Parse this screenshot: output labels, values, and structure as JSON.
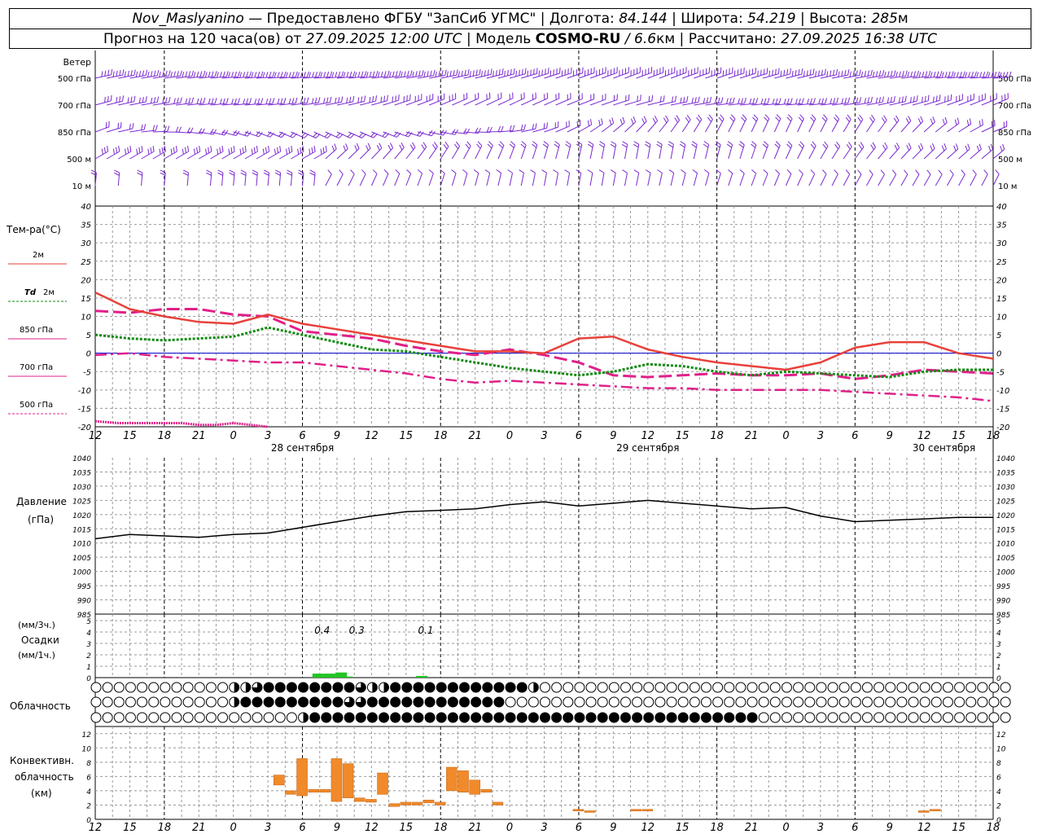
{
  "header": {
    "station": "Nov_Maslyanino",
    "provider": " — Предоставлено ФГБУ \"ЗапСиб УГМС\" | Долгота: ",
    "lon": "84.144",
    "lat_label": " | Широта: ",
    "lat": "54.219",
    "alt_label": " | Высота: ",
    "alt": "285",
    "alt_unit": "м",
    "forecast_label": "Прогноз на 120 часа(ов) от ",
    "forecast_time": "27.09.2025 12:00 UTC",
    "model_label": "  | Модель ",
    "model": "COSMO-RU",
    "model_res": " / 6.6",
    "model_res_unit": "км | Рассчитано: ",
    "calc_time": "27.09.2025 16:38 UTC"
  },
  "colors": {
    "t2m": "#e8413a",
    "td2m": "#108a10",
    "t850": "#e0208a",
    "t700": "#e0208a",
    "t500": "#e0208a",
    "wind": "#7a2ad0",
    "pressure": "#000000",
    "precip": "#22c422",
    "convective": "#f08a2a",
    "grid": "#999999"
  },
  "chart_data": [
    {
      "type": "wind_barbs",
      "title": "Ветер",
      "levels": [
        "500 гПа",
        "700 гПа",
        "850 гПа",
        "500 м",
        "10 м"
      ]
    },
    {
      "type": "line",
      "title": "Тем-ра(°C)",
      "ylim": [
        -20,
        40
      ],
      "yticks": [
        40,
        35,
        30,
        25,
        20,
        15,
        10,
        5,
        0,
        -5,
        -10,
        -15,
        -20
      ],
      "x_hours": [
        0,
        6,
        12,
        18,
        24,
        30,
        36,
        42,
        48,
        54,
        60,
        66,
        72,
        78,
        84,
        90,
        96,
        102,
        108,
        114,
        120
      ],
      "x_tick_labels": [
        "12",
        "15",
        "18",
        "21",
        "0",
        "3",
        "6",
        "9",
        "12",
        "15",
        "18",
        "21",
        "0",
        "3",
        "6",
        "9",
        "12",
        "15",
        "18",
        "21",
        "0",
        "3",
        "6",
        "9",
        "12",
        "15",
        "18"
      ],
      "date_labels": [
        "28 сентября",
        "29 сентября",
        "30 сентября"
      ],
      "series": [
        {
          "name": "2м",
          "label": "2м",
          "style": "solid",
          "values": [
            16.5,
            12.0,
            10.0,
            8.5,
            8.0,
            10.5,
            8.0,
            6.5,
            5.0,
            3.5,
            2.0,
            0.5,
            0.5,
            0.0,
            4.0,
            4.5,
            1.0,
            -1.0,
            -2.5,
            -3.5,
            -4.5
          ]
        },
        {
          "name": "Td 2м",
          "label": "Td",
          "label_suffix": "2м",
          "style": "dot",
          "values": [
            5.0,
            4.0,
            3.5,
            4.0,
            4.5,
            7.0,
            5.0,
            3.0,
            1.0,
            0.5,
            -1.0,
            -2.5,
            -4.0,
            -5.0,
            -6.0,
            -5.0,
            -3.0,
            -3.5,
            -5.0,
            -6.0,
            -5.0
          ]
        },
        {
          "name": "850 гПа",
          "label": "850 гПа",
          "style": "dash",
          "values": [
            11.5,
            11.0,
            12.0,
            12.0,
            10.5,
            10.0,
            6.0,
            5.0,
            4.0,
            2.0,
            0.5,
            -0.5,
            1.0,
            -0.5,
            -2.5,
            -6.0,
            -6.5,
            -6.0,
            -5.5,
            -6.0,
            -6.0
          ]
        },
        {
          "name": "700 гПа",
          "label": "700 гПа",
          "style": "dashdot",
          "values": [
            -0.5,
            0.0,
            -1.0,
            -1.5,
            -2.0,
            -2.5,
            -2.5,
            -3.5,
            -4.5,
            -5.5,
            -7.0,
            -8.0,
            -7.5,
            -8.0,
            -8.5,
            -9.0,
            -9.5,
            -9.5,
            -10.0,
            -10.0,
            -10.0
          ]
        },
        {
          "name": "500 гПа",
          "label": "500 гПа",
          "style": "dense",
          "x_hours": [
            0,
            4,
            8,
            12,
            15,
            18,
            21,
            24,
            27,
            30
          ],
          "values": [
            -18.5,
            -19.0,
            -19.0,
            -19.0,
            -19.0,
            -19.5,
            -19.5,
            -19.0,
            -19.5,
            -20.0
          ]
        }
      ],
      "x_days_ext": {
        "x_hours": [
          0,
          6,
          12,
          18,
          24,
          30,
          36,
          42,
          48,
          54,
          60,
          66,
          72,
          78,
          84,
          90,
          96,
          102,
          108,
          114,
          120,
          126,
          132,
          138,
          144,
          150,
          156
        ]
      },
      "t2m_full": [
        16.5,
        12.0,
        10.0,
        8.5,
        8.0,
        10.5,
        8.0,
        6.5,
        5.0,
        3.5,
        2.0,
        0.5,
        0.5,
        0.0,
        4.0,
        4.5,
        1.0,
        -1.0,
        -2.5,
        -3.5,
        -4.5,
        -2.5,
        1.5,
        3.0,
        3.0,
        0.0,
        -1.5
      ],
      "td_full": [
        5.0,
        4.0,
        3.5,
        4.0,
        4.5,
        7.0,
        5.0,
        3.0,
        1.0,
        0.5,
        -1.0,
        -2.5,
        -4.0,
        -5.0,
        -6.0,
        -5.0,
        -3.0,
        -3.5,
        -5.0,
        -6.0,
        -5.0,
        -5.5,
        -6.0,
        -6.5,
        -5.0,
        -4.5,
        -4.5
      ],
      "t850_full": [
        11.5,
        11.0,
        12.0,
        12.0,
        10.5,
        10.0,
        6.0,
        5.0,
        4.0,
        2.0,
        0.5,
        -0.5,
        1.0,
        -0.5,
        -2.5,
        -6.0,
        -6.5,
        -6.0,
        -5.5,
        -6.0,
        -6.0,
        -5.5,
        -7.0,
        -6.0,
        -4.5,
        -5.0,
        -5.5
      ],
      "t700_full": [
        -0.5,
        0.0,
        -1.0,
        -1.5,
        -2.0,
        -2.5,
        -2.5,
        -3.5,
        -4.5,
        -5.5,
        -7.0,
        -8.0,
        -7.5,
        -8.0,
        -8.5,
        -9.0,
        -9.5,
        -9.5,
        -10.0,
        -10.0,
        -10.0,
        -10.0,
        -10.5,
        -11.0,
        -11.5,
        -12.0,
        -13.0
      ]
    },
    {
      "type": "line",
      "title": "Давление",
      "unit": "(гПа)",
      "ylim": [
        985,
        1040
      ],
      "yticks": [
        1040,
        1035,
        1030,
        1025,
        1020,
        1015,
        1010,
        1005,
        1000,
        995,
        990,
        985
      ],
      "x_hours": [
        0,
        6,
        12,
        18,
        24,
        30,
        36,
        42,
        48,
        54,
        60,
        66,
        72,
        78,
        84,
        90,
        96,
        102,
        108,
        114,
        120,
        126,
        132,
        138,
        144,
        150,
        156
      ],
      "series": [
        {
          "name": "Давление",
          "values": [
            1011.5,
            1013.0,
            1012.5,
            1012.0,
            1013.0,
            1013.5,
            1015.5,
            1017.5,
            1019.5,
            1021.0,
            1021.5,
            1022.0,
            1023.5,
            1024.5,
            1023.0,
            1024.0,
            1025.0,
            1024.0,
            1023.0,
            1022.0,
            1022.5,
            1019.5,
            1017.5,
            1018.0,
            1018.5,
            1019.0,
            1019.0
          ]
        }
      ]
    },
    {
      "type": "bar",
      "title": "Осадки",
      "unit_top": "(мм/3ч.)",
      "unit_bottom": "(мм/1ч.)",
      "ylim": [
        0,
        5
      ],
      "yticks": [
        5,
        4,
        3,
        2,
        1,
        0
      ],
      "annotations": [
        {
          "x_hour": 39,
          "text": "0.4"
        },
        {
          "x_hour": 45,
          "text": "0.3"
        },
        {
          "x_hour": 57,
          "text": "0.1"
        }
      ],
      "bars": [
        {
          "x_hour": 39,
          "w": 2,
          "value": 0.35
        },
        {
          "x_hour": 41,
          "w": 2,
          "value": 0.35
        },
        {
          "x_hour": 43,
          "w": 2,
          "value": 0.45
        },
        {
          "x_hour": 45,
          "w": 1,
          "value": 0.1
        },
        {
          "x_hour": 57,
          "w": 2,
          "value": 0.15
        }
      ]
    },
    {
      "type": "table",
      "title": "Облачность",
      "rows": [
        "0000000000002345555555542255555555555520000000000000000000000000000000000000000000000000045215555553555555541",
        "00000000000025555555554455555555555500000000000000000000000000000000000000000000000000000000000002555555555",
        "00000000000000000025555555555555555555555555555555555555550000000000000000000000000000000000000000000000000000"
      ]
    },
    {
      "type": "bar",
      "title": "Конвективн.",
      "title2": "облачность",
      "unit": "(км)",
      "ylim": [
        0,
        13
      ],
      "yticks": [
        12,
        10,
        8,
        6,
        4,
        2,
        0
      ],
      "bars": [
        {
          "x_hour": 32,
          "base": 4.8,
          "top": 6.2
        },
        {
          "x_hour": 34,
          "base": 3.5,
          "top": 4.0
        },
        {
          "x_hour": 36,
          "base": 3.3,
          "top": 8.5
        },
        {
          "x_hour": 38,
          "base": 3.8,
          "top": 4.2
        },
        {
          "x_hour": 40,
          "base": 3.8,
          "top": 4.2
        },
        {
          "x_hour": 42,
          "base": 2.5,
          "top": 8.5
        },
        {
          "x_hour": 44,
          "base": 3.0,
          "top": 7.8
        },
        {
          "x_hour": 46,
          "base": 2.5,
          "top": 3.0
        },
        {
          "x_hour": 48,
          "base": 2.4,
          "top": 2.8
        },
        {
          "x_hour": 50,
          "base": 3.5,
          "top": 6.5
        },
        {
          "x_hour": 52,
          "base": 1.8,
          "top": 2.2
        },
        {
          "x_hour": 54,
          "base": 2.0,
          "top": 2.4
        },
        {
          "x_hour": 56,
          "base": 2.0,
          "top": 2.4
        },
        {
          "x_hour": 58,
          "base": 2.3,
          "top": 2.7
        },
        {
          "x_hour": 60,
          "base": 2.0,
          "top": 2.4
        },
        {
          "x_hour": 62,
          "base": 4.0,
          "top": 7.3
        },
        {
          "x_hour": 64,
          "base": 3.8,
          "top": 6.8
        },
        {
          "x_hour": 66,
          "base": 3.5,
          "top": 5.5
        },
        {
          "x_hour": 68,
          "base": 3.8,
          "top": 4.2
        },
        {
          "x_hour": 70,
          "base": 2.0,
          "top": 2.4
        },
        {
          "x_hour": 84,
          "base": 1.2,
          "top": 1.4
        },
        {
          "x_hour": 86,
          "base": 1.0,
          "top": 1.2
        },
        {
          "x_hour": 94,
          "base": 1.2,
          "top": 1.4
        },
        {
          "x_hour": 96,
          "base": 1.2,
          "top": 1.4
        },
        {
          "x_hour": 144,
          "base": 1.0,
          "top": 1.2
        },
        {
          "x_hour": 146,
          "base": 1.2,
          "top": 1.4
        }
      ]
    }
  ]
}
